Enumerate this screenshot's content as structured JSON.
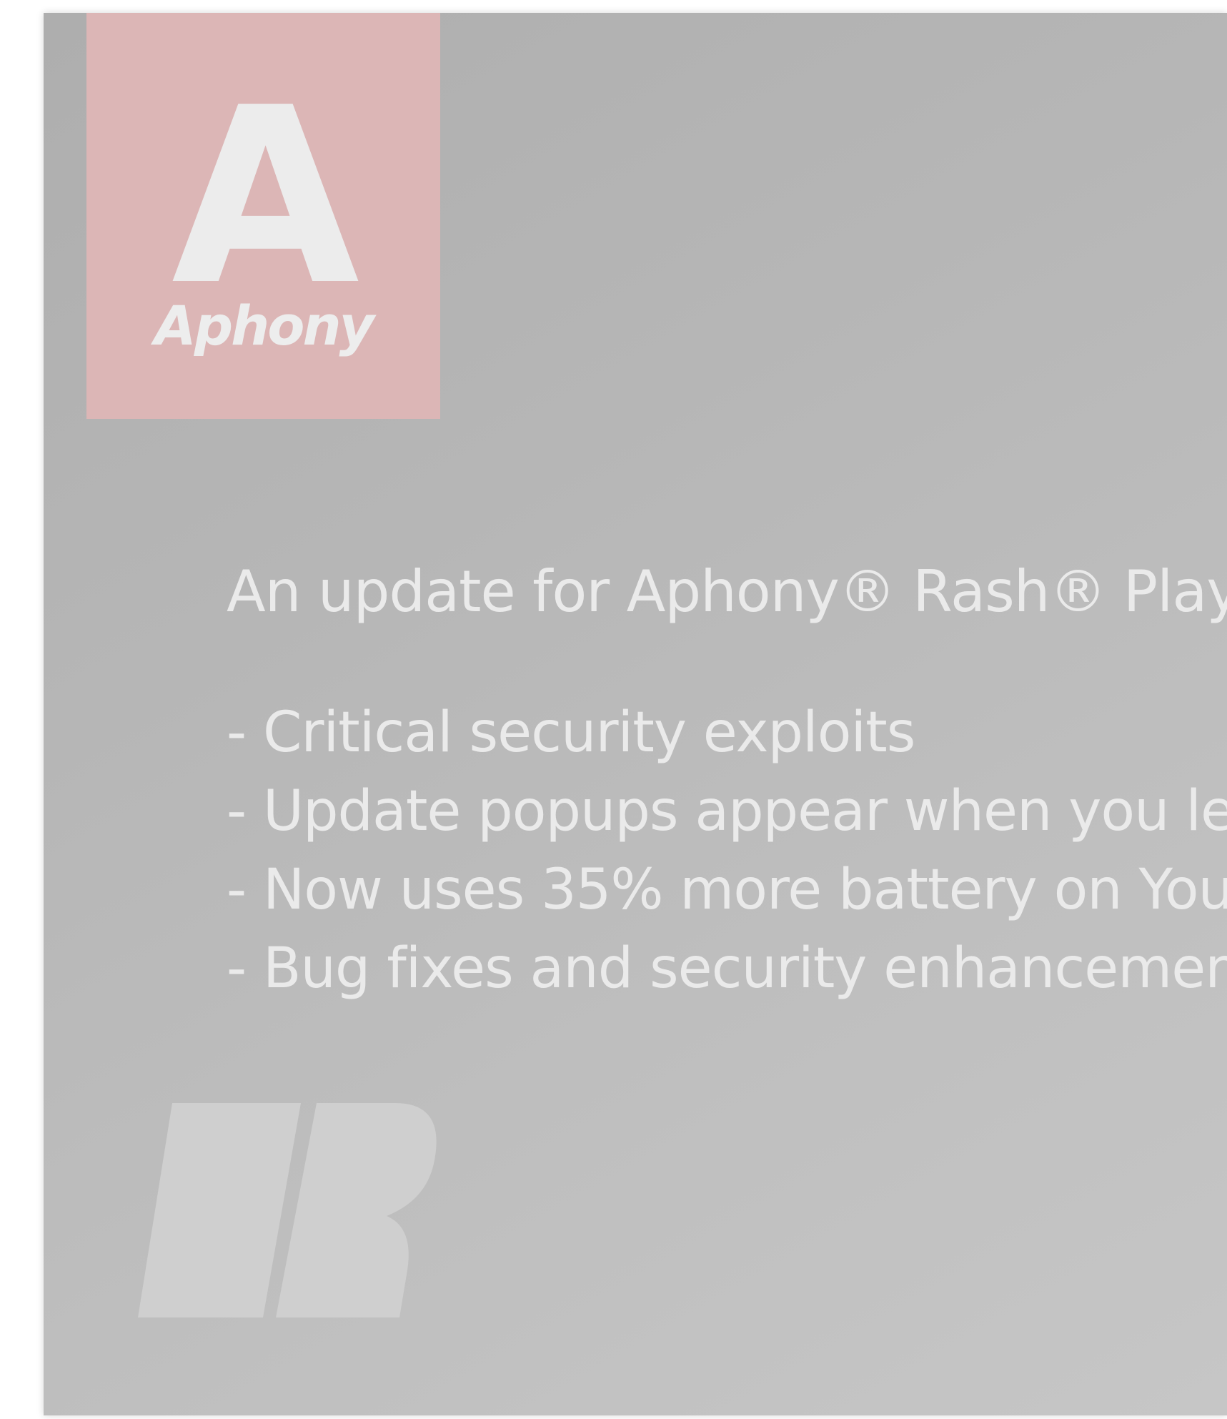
{
  "logo": {
    "letter": "A",
    "wordmark": "Aphony"
  },
  "message": {
    "headline": "An update for Aphony® Rash® Player",
    "bullets": [
      "- Critical security exploits",
      "- Update popups appear when you le",
      "- Now uses 35% more battery on You",
      "- Bug fixes and security enhancemen"
    ]
  },
  "colors": {
    "logo_tile": "#dcb6b6",
    "panel": "#b6b6b6",
    "text": "#eaeaea",
    "brand_mark": "#cfcfcf"
  }
}
